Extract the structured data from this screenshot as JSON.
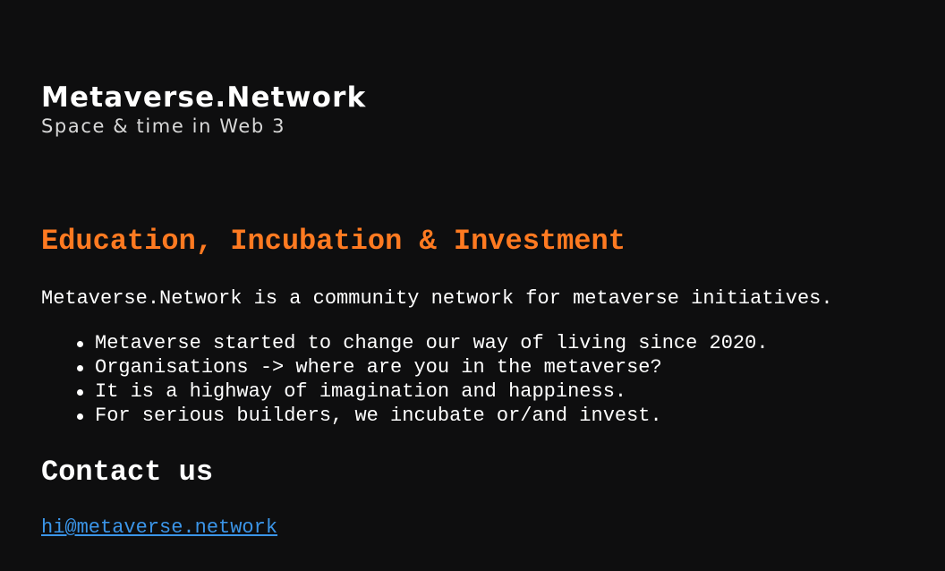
{
  "brand": {
    "title": "Metaverse.Network",
    "tagline": "Space & time in Web 3"
  },
  "main": {
    "heading": "Education, Incubation & Investment",
    "intro": "Metaverse.Network is a community network for metaverse initiatives.",
    "bullets": [
      "Metaverse started to change our way of living since 2020.",
      "Organisations -> where are you in the metaverse?",
      "It is a highway of imagination and happiness.",
      "For serious builders, we incubate or/and invest."
    ]
  },
  "contact": {
    "heading": "Contact us",
    "email": "hi@metaverse.network",
    "email_href": "mailto:hi@metaverse.network"
  },
  "colors": {
    "background": "#0e0e0f",
    "accent": "#ff7a21",
    "link": "#3b95e8",
    "text": "#ffffff"
  }
}
